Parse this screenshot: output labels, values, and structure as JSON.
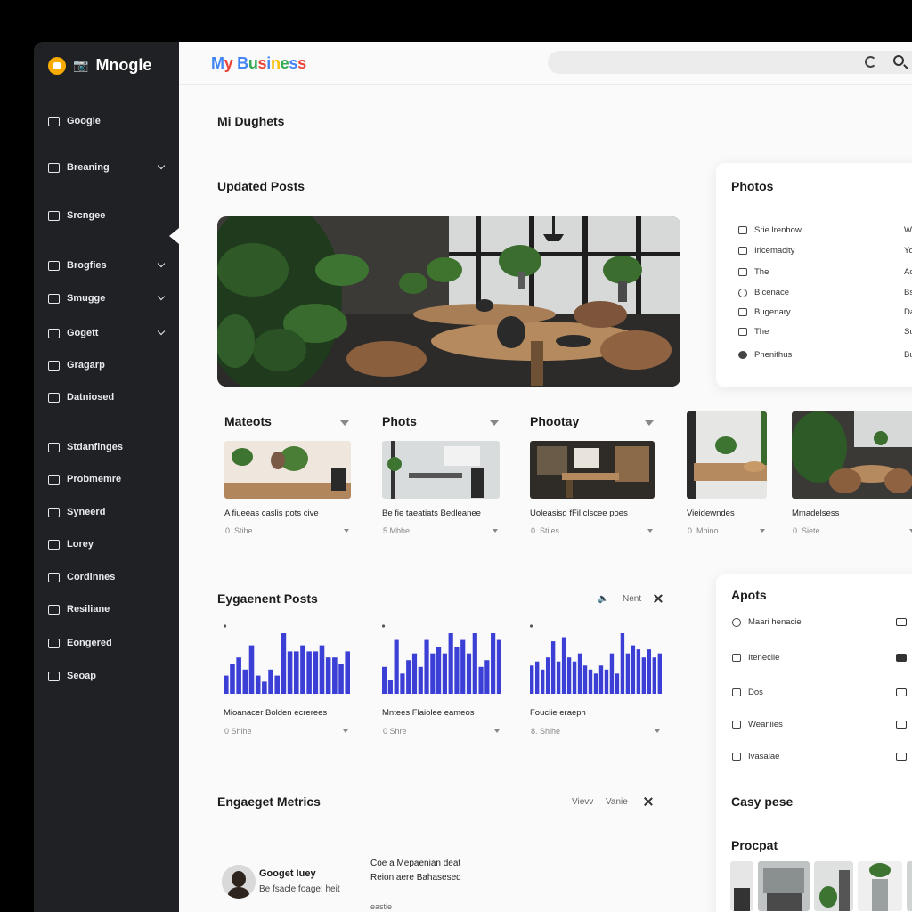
{
  "sidebar": {
    "brand": "Mnogle",
    "items": [
      {
        "label": "Google",
        "chevron": false
      },
      {
        "label": "Breaning",
        "chevron": true
      },
      {
        "label": "Srcngee",
        "chevron": false
      },
      {
        "label": "Brogfies",
        "chevron": true
      },
      {
        "label": "Smugge",
        "chevron": true
      },
      {
        "label": "Gogett",
        "chevron": true
      },
      {
        "label": "Gragarp",
        "chevron": false
      },
      {
        "label": "Datniosed",
        "chevron": false
      },
      {
        "label": "Stdanfinges",
        "chevron": false
      },
      {
        "label": "Probmemre",
        "chevron": false
      },
      {
        "label": "Syneerd",
        "chevron": false
      },
      {
        "label": "Lorey",
        "chevron": false
      },
      {
        "label": "Cordinnes",
        "chevron": false
      },
      {
        "label": "Resiliane",
        "chevron": false
      },
      {
        "label": "Eongered",
        "chevron": false
      },
      {
        "label": "Seoap",
        "chevron": false
      }
    ]
  },
  "header": {
    "logo": [
      "M",
      "y",
      " ",
      "B",
      "u",
      "s",
      "i",
      "n",
      "e",
      "s",
      "s"
    ],
    "logo_colors": [
      "#4285f4",
      "#ea4335",
      "#fbbc05",
      "#4285f4",
      "#34a853",
      "#ea4335",
      "#4285f4",
      "#fbbc05",
      "#34a853",
      "#4285f4",
      "#ea4335"
    ]
  },
  "page": {
    "title": "Mi Dughets",
    "updated_posts": "Updated Posts"
  },
  "post_cards": [
    {
      "title": "Mateots",
      "caption": "A fiueeas caslis pots cive",
      "meta": "0. Stihe"
    },
    {
      "title": "Phots",
      "caption": "Be fie taeatiats Bedleanee",
      "meta": "5 Mbhe"
    },
    {
      "title": "Phootay",
      "caption": "Uoleasisg fFil clscee poes",
      "meta": "0. Stiles"
    },
    {
      "title": "",
      "caption": "Vieidewndes",
      "meta": "0. Mbino"
    },
    {
      "title": "",
      "caption": "Mmadelsess",
      "meta": "0. Siete"
    }
  ],
  "photos_panel": {
    "title": "Photos",
    "rows": [
      {
        "label": "Srie lrenhow",
        "right": "W"
      },
      {
        "label": "Iricemacity",
        "right": "Yo"
      },
      {
        "label": "The",
        "right": "Ac"
      },
      {
        "label": "Bicenace",
        "right": "Bs"
      },
      {
        "label": "Bugenary",
        "right": "Da"
      },
      {
        "label": "The",
        "right": "Su"
      },
      {
        "label": "Pnenithus",
        "right": "Bu"
      }
    ]
  },
  "engagement": {
    "title": "Eygaenent Posts",
    "link": "Nent",
    "charts": [
      {
        "caption": "Mioanacer Bolden ecrerees",
        "meta": "0 Shihe"
      },
      {
        "caption": "Mntees Flaiolee eameos",
        "meta": "0 Shre"
      },
      {
        "caption": "Fouciie eraeph",
        "meta": "8. Shihe"
      }
    ]
  },
  "chart_data": [
    {
      "type": "bar",
      "values": [
        3,
        5,
        6,
        4,
        8,
        3,
        2,
        4,
        3,
        10,
        7,
        7,
        8,
        7,
        7,
        8,
        6,
        6,
        5,
        7
      ]
    },
    {
      "type": "bar",
      "values": [
        4,
        2,
        8,
        3,
        5,
        6,
        4,
        8,
        6,
        7,
        6,
        9,
        7,
        8,
        6,
        9,
        4,
        5,
        9,
        8
      ]
    },
    {
      "type": "bar",
      "values": [
        7,
        8,
        6,
        9,
        13,
        8,
        14,
        9,
        8,
        10,
        7,
        6,
        5,
        7,
        6,
        10,
        5,
        15,
        10,
        12,
        11,
        9,
        11,
        9,
        10
      ]
    }
  ],
  "apots_panel": {
    "title": "Apots",
    "rows": [
      "Maari henacie",
      "Itenecile",
      "Dos",
      "Weaniies",
      "Ivasaiae"
    ]
  },
  "metrics": {
    "title": "Engaeget Metrics",
    "link_a": "Vievv",
    "link_b": "Vanie",
    "user_name": "Googet Iuey",
    "user_sub": "Be fsacle foage: heit",
    "detail_1": "Coe a Mepaenian deat",
    "detail_2": "Reion aere Bahasesed",
    "detail_3": "eastie"
  },
  "side_lower": {
    "heading_1": "Casy pese",
    "heading_2": "Procpat"
  }
}
